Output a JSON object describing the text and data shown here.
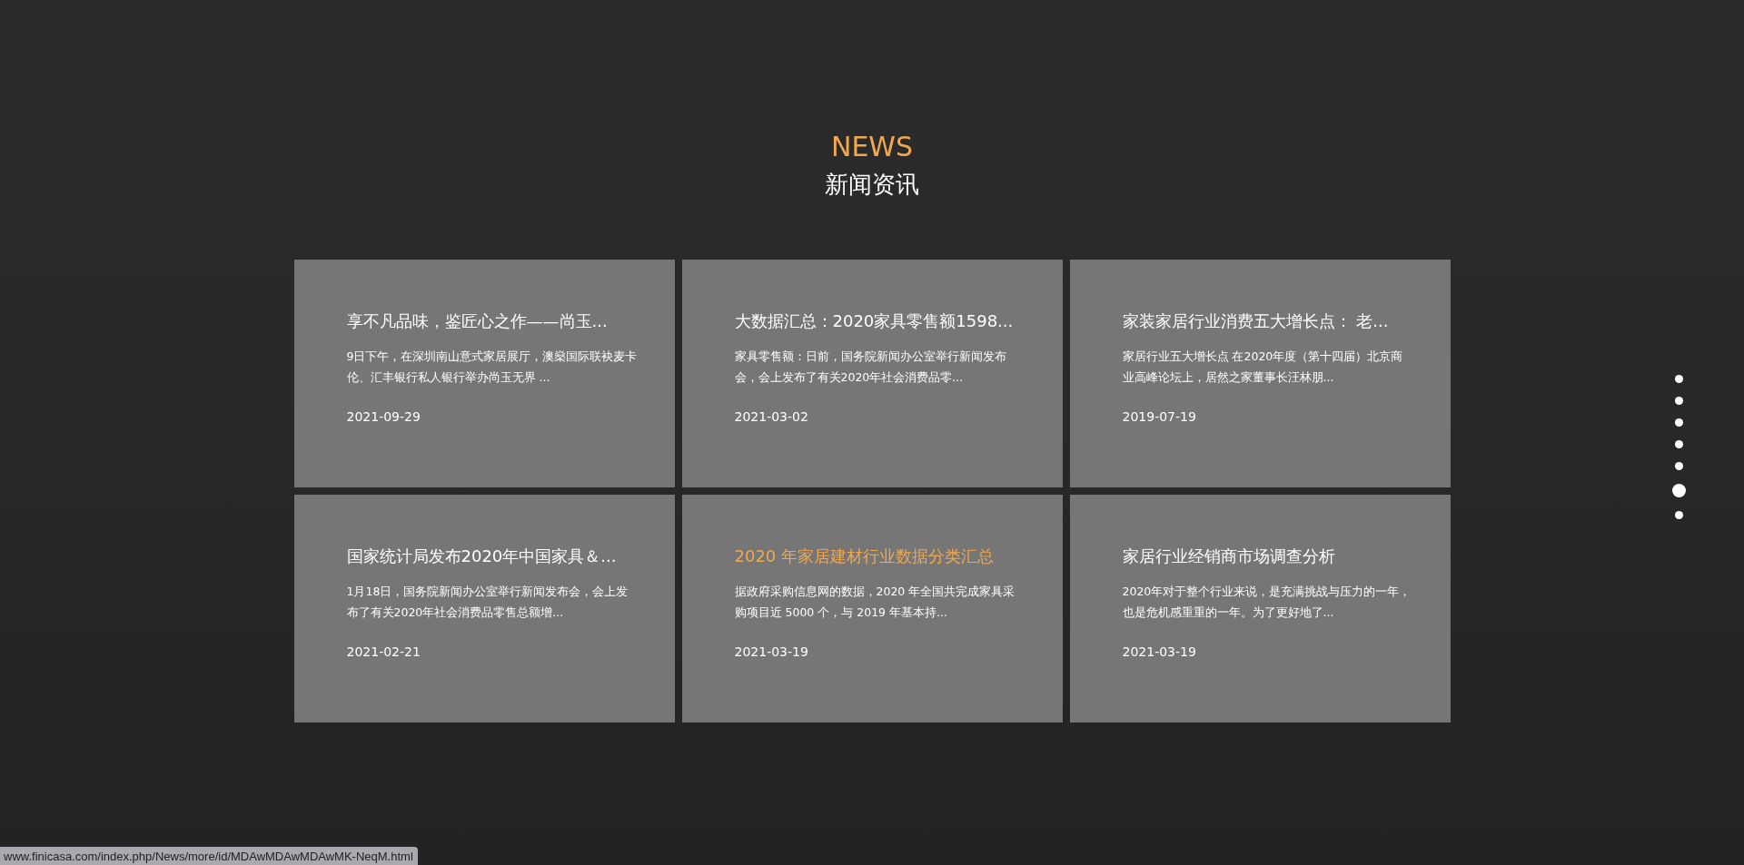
{
  "heading": {
    "english": "NEWS",
    "chinese": "新闻资讯"
  },
  "news": [
    {
      "title": "享不凡品味，鉴匠心之作——尚玉...",
      "summary": "9日下午，在深圳南山意式家居展厅，澳燊国际联袂麦卡伦、汇丰银行私人银行举办尚玉无界 ...",
      "date": "2021-09-29",
      "highlighted": false
    },
    {
      "title": "大数据汇总：2020家具零售额1598...",
      "summary": "家具零售额：日前，国务院新闻办公室举行新闻发布会，会上发布了有关2020年社会消费品零...",
      "date": "2021-03-02",
      "highlighted": false
    },
    {
      "title": "家装家居行业消费五大增长点： 老...",
      "summary": "家居行业五大增长点 在2020年度（第十四届）北京商业高峰论坛上，居然之家董事长汪林朋...",
      "date": "2019-07-19",
      "highlighted": false
    },
    {
      "title": "国家统计局发布2020年中国家具＆...",
      "summary": "1月18日，国务院新闻办公室举行新闻发布会，会上发布了有关2020年社会消费品零售总额增...",
      "date": "2021-02-21",
      "highlighted": false
    },
    {
      "title": "2020 年家居建材行业数据分类汇总",
      "summary": "据政府采购信息网的数据，2020 年全国共完成家具采购项目近 5000 个，与 2019 年基本持...",
      "date": "2021-03-19",
      "highlighted": true
    },
    {
      "title": "家居行业经销商市场调查分析",
      "summary": "2020年对于整个行业来说，是充满挑战与压力的一年，也是危机感重重的一年。为了更好地了...",
      "date": "2021-03-19",
      "highlighted": false
    }
  ],
  "page_dots": [
    {
      "selected": false
    },
    {
      "selected": false
    },
    {
      "selected": false
    },
    {
      "selected": false
    },
    {
      "selected": false
    },
    {
      "selected": true
    },
    {
      "selected": false
    }
  ],
  "status_bar": {
    "url": "www.finicasa.com/index.php/News/more/id/MDAwMDAwMDAwMK-NeqM.html"
  }
}
